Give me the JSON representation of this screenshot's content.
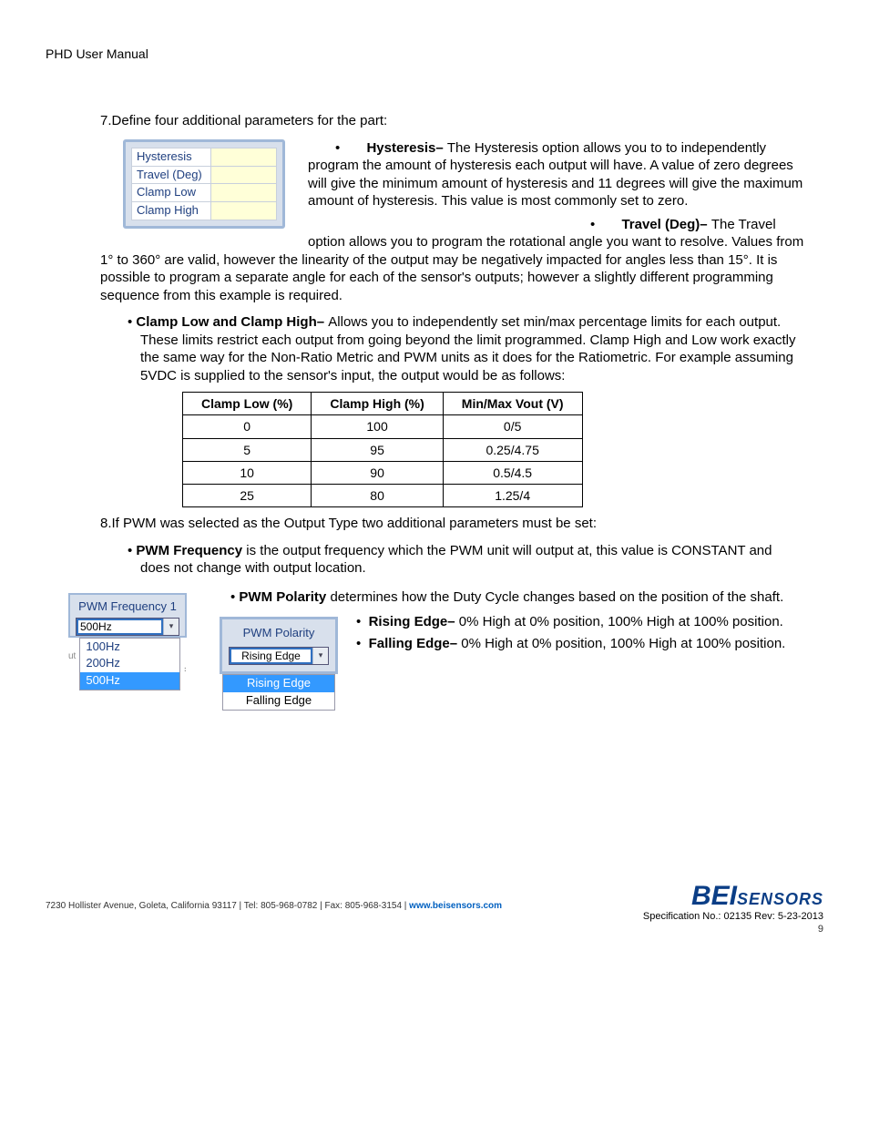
{
  "header": "PHD User Manual",
  "step7": {
    "num": "7.",
    "text": "Define four additional parameters for the part:",
    "params_box": [
      "Hysteresis",
      "Travel (Deg)",
      "Clamp Low",
      "Clamp High"
    ],
    "hyst_label": "Hysteresis– ",
    "hyst_text_a": "The Hysteresis option allows you to to independently program the amount of hysteresis each output will have. A value of zero degrees will give the minimum amount of hysteresis and 11 degrees will give the maximum amount of hysteresis.    This value is most commonly set to zero.",
    "travel_label": "Travel (Deg)– ",
    "travel_text": "The Travel option allows you to program the rotational angle you want to resolve. Values from 1° to 360° are valid, however the linearity of the output may be negatively impacted for angles less than 15°.  It is possible to program a separate angle for each of the sensor's outputs; however a slightly different programming sequence from this example is required.",
    "clamp_label": "Clamp Low and Clamp High–  ",
    "clamp_text": "Allows you to independently set min/max percentage limits for each output. These limits restrict each output from going beyond the limit programmed.  Clamp High and Low work exactly the same way for the Non-Ratio Metric and PWM units as it does for the Ratiometric. For example assuming 5VDC is supplied to the sensor's input, the output would be as follows:"
  },
  "chart_data": {
    "type": "table",
    "headers": [
      "Clamp Low (%)",
      "Clamp High (%)",
      "Min/Max Vout (V)"
    ],
    "rows": [
      [
        "0",
        "100",
        "0/5"
      ],
      [
        "5",
        "95",
        "0.25/4.75"
      ],
      [
        "10",
        "90",
        "0.5/4.5"
      ],
      [
        "25",
        "80",
        "1.25/4"
      ]
    ]
  },
  "step8": {
    "num": "8.",
    "text": "If PWM was selected as the Output Type two additional parameters must be set:",
    "pwm_freq_label": "PWM Frequency",
    "pwm_freq_text": " is the output frequency which the PWM unit will output at, this value is CONSTANT and does not change with output location.",
    "pwm_pol_label": "PWM Polarity",
    "pwm_pol_text": " determines how the Duty Cycle changes based on the position of the shaft.",
    "rising_label": "Rising Edge– ",
    "rising_text": "0% High at 0% position, 100% High at 100% position.",
    "falling_label": "Falling Edge–  ",
    "falling_text": "0% High at 0% position, 100% High at 100% position."
  },
  "pwm_freq_box": {
    "title": "PWM Frequency 1",
    "selected": "500Hz",
    "options": [
      "100Hz",
      "200Hz",
      "500Hz"
    ],
    "highlighted": "500Hz"
  },
  "pwm_pol_box": {
    "title": "PWM Polarity",
    "selected": "Rising Edge",
    "options": [
      "Rising Edge",
      "Falling Edge"
    ],
    "highlighted": "Rising Edge"
  },
  "footer": {
    "address": "7230 Hollister Avenue, Goleta, California 93117  |  Tel: 805-968-0782  | Fax: 805-968-3154  |  ",
    "link": "www.beisensors.com",
    "spec": "Specification No.:  02135   Rev: 5-23-2013",
    "page": "9",
    "logo_a": "BEI",
    "logo_b": "SENSORS"
  }
}
